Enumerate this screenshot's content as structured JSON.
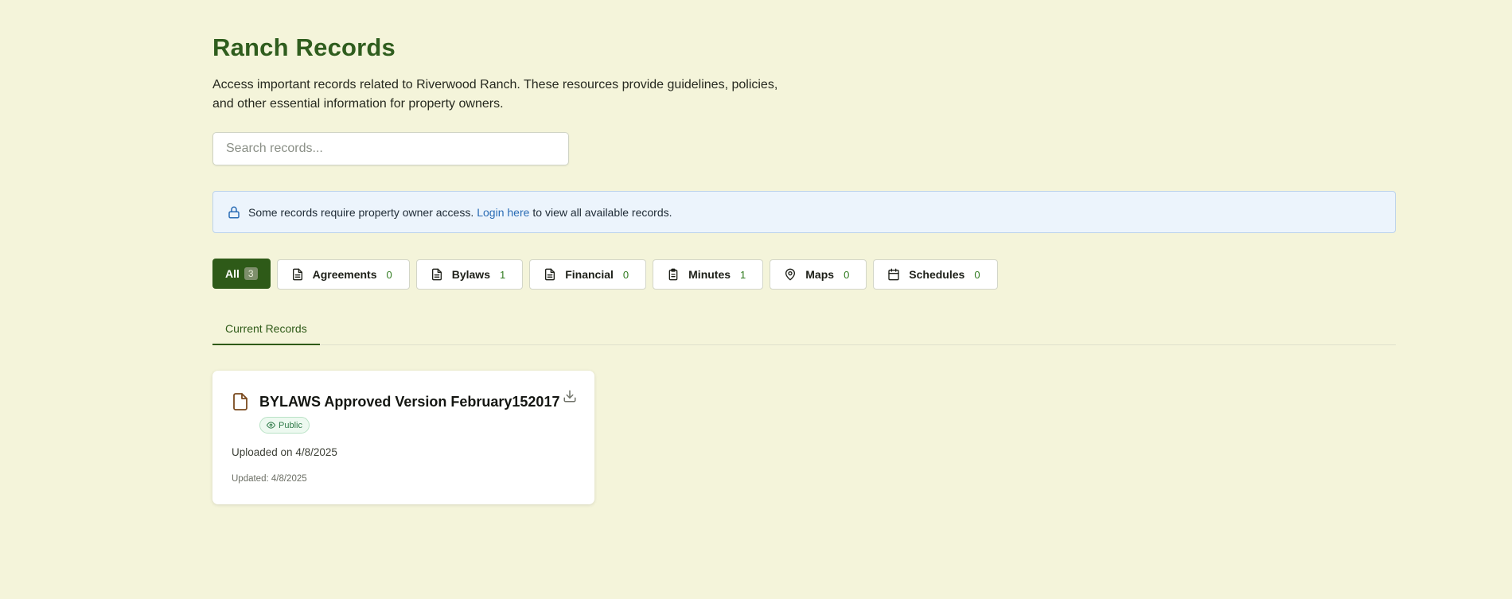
{
  "header": {
    "title": "Ranch Records",
    "description": "Access important records related to Riverwood Ranch. These resources provide guidelines, policies, and other essential information for property owners."
  },
  "search": {
    "placeholder": "Search records..."
  },
  "notice": {
    "icon": "lock-icon",
    "text_before": "Some records require property owner access.",
    "link": "Login here",
    "text_after": "to view all available records."
  },
  "filters": {
    "all": {
      "label": "All",
      "count": "3"
    },
    "items": [
      {
        "label": "Agreements",
        "count": "0",
        "icon": "document-icon"
      },
      {
        "label": "Bylaws",
        "count": "1",
        "icon": "document-icon"
      },
      {
        "label": "Financial",
        "count": "0",
        "icon": "document-icon"
      },
      {
        "label": "Minutes",
        "count": "1",
        "icon": "clipboard-icon"
      },
      {
        "label": "Maps",
        "count": "0",
        "icon": "map-pin-icon"
      },
      {
        "label": "Schedules",
        "count": "0",
        "icon": "calendar-icon"
      }
    ]
  },
  "tabs": {
    "active": "Current Records"
  },
  "records": [
    {
      "title": "BYLAWS Approved Version February152017",
      "visibility": "Public",
      "uploaded": "Uploaded on 4/8/2025",
      "updated": "Updated: 4/8/2025"
    }
  ],
  "colors": {
    "background": "#f4f4da",
    "accent": "#2e5a18",
    "link": "#2a6cb5",
    "notice_bg": "#ecf4fc"
  }
}
